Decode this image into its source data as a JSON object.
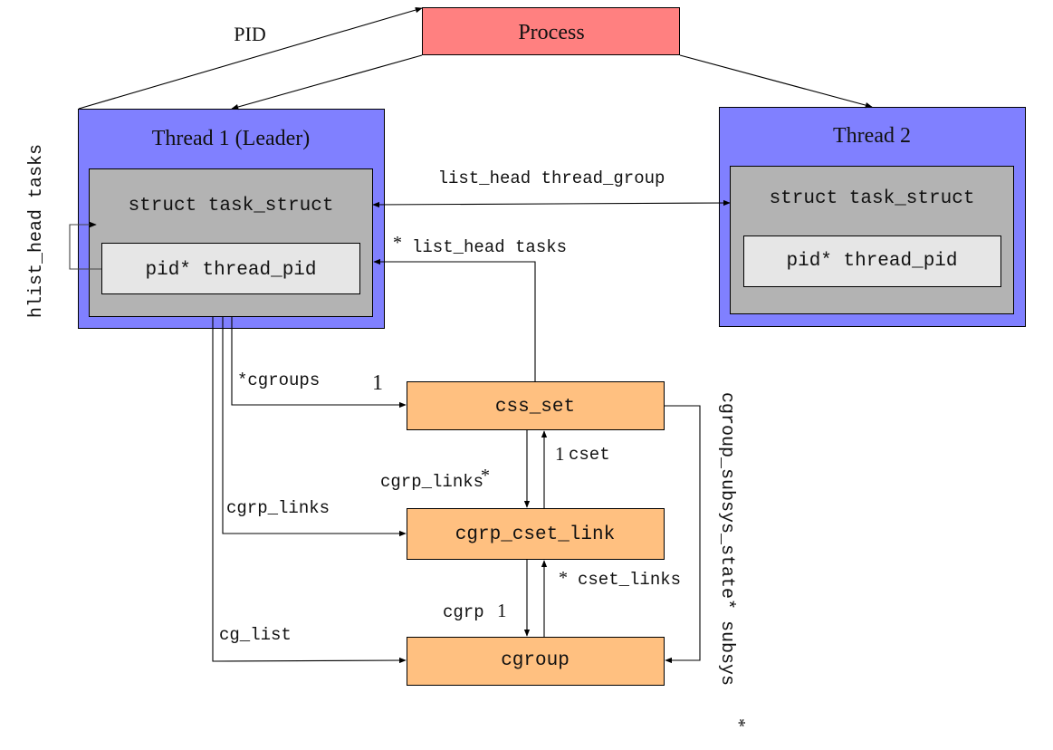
{
  "colors": {
    "process_fill": "#ff8080",
    "thread_fill": "#8080ff",
    "task_struct_fill": "#b3b3b3",
    "pid_fill": "#e6e6e6",
    "cgroup_node_fill": "#ffc080",
    "stroke": "#000000"
  },
  "nodes": {
    "process": {
      "label": "Process"
    },
    "thread1": {
      "title": "Thread 1 (Leader)",
      "task_struct": "struct task_struct",
      "pid": "pid* thread_pid"
    },
    "thread2": {
      "title": "Thread 2",
      "task_struct": "struct task_struct",
      "pid": "pid* thread_pid"
    },
    "css_set": {
      "label": "css_set"
    },
    "cgrp_cset_link": {
      "label": "cgrp_cset_link"
    },
    "cgroup": {
      "label": "cgroup"
    }
  },
  "edge_labels": {
    "pid": "PID",
    "hlist_head_tasks": "hlist_head tasks",
    "thread_group": "list_head thread_group",
    "list_head_tasks_star": "*",
    "list_head_tasks": "list_head tasks",
    "cgroups": "*cgroups",
    "cgroups_mult": "1",
    "cgrp_links_left": "cgrp_links",
    "cg_list": "cg_list",
    "cgrp_links_mid": "cgrp_links",
    "cgrp_links_mult": "*",
    "cset_mult": "1",
    "cset": "cset",
    "cgrp": "cgrp",
    "cgrp_mult": "1",
    "cset_links_mult": "*",
    "cset_links": "cset_links",
    "subsys": "cgroup_subsys_state* subsys",
    "subsys_mult": "*"
  }
}
